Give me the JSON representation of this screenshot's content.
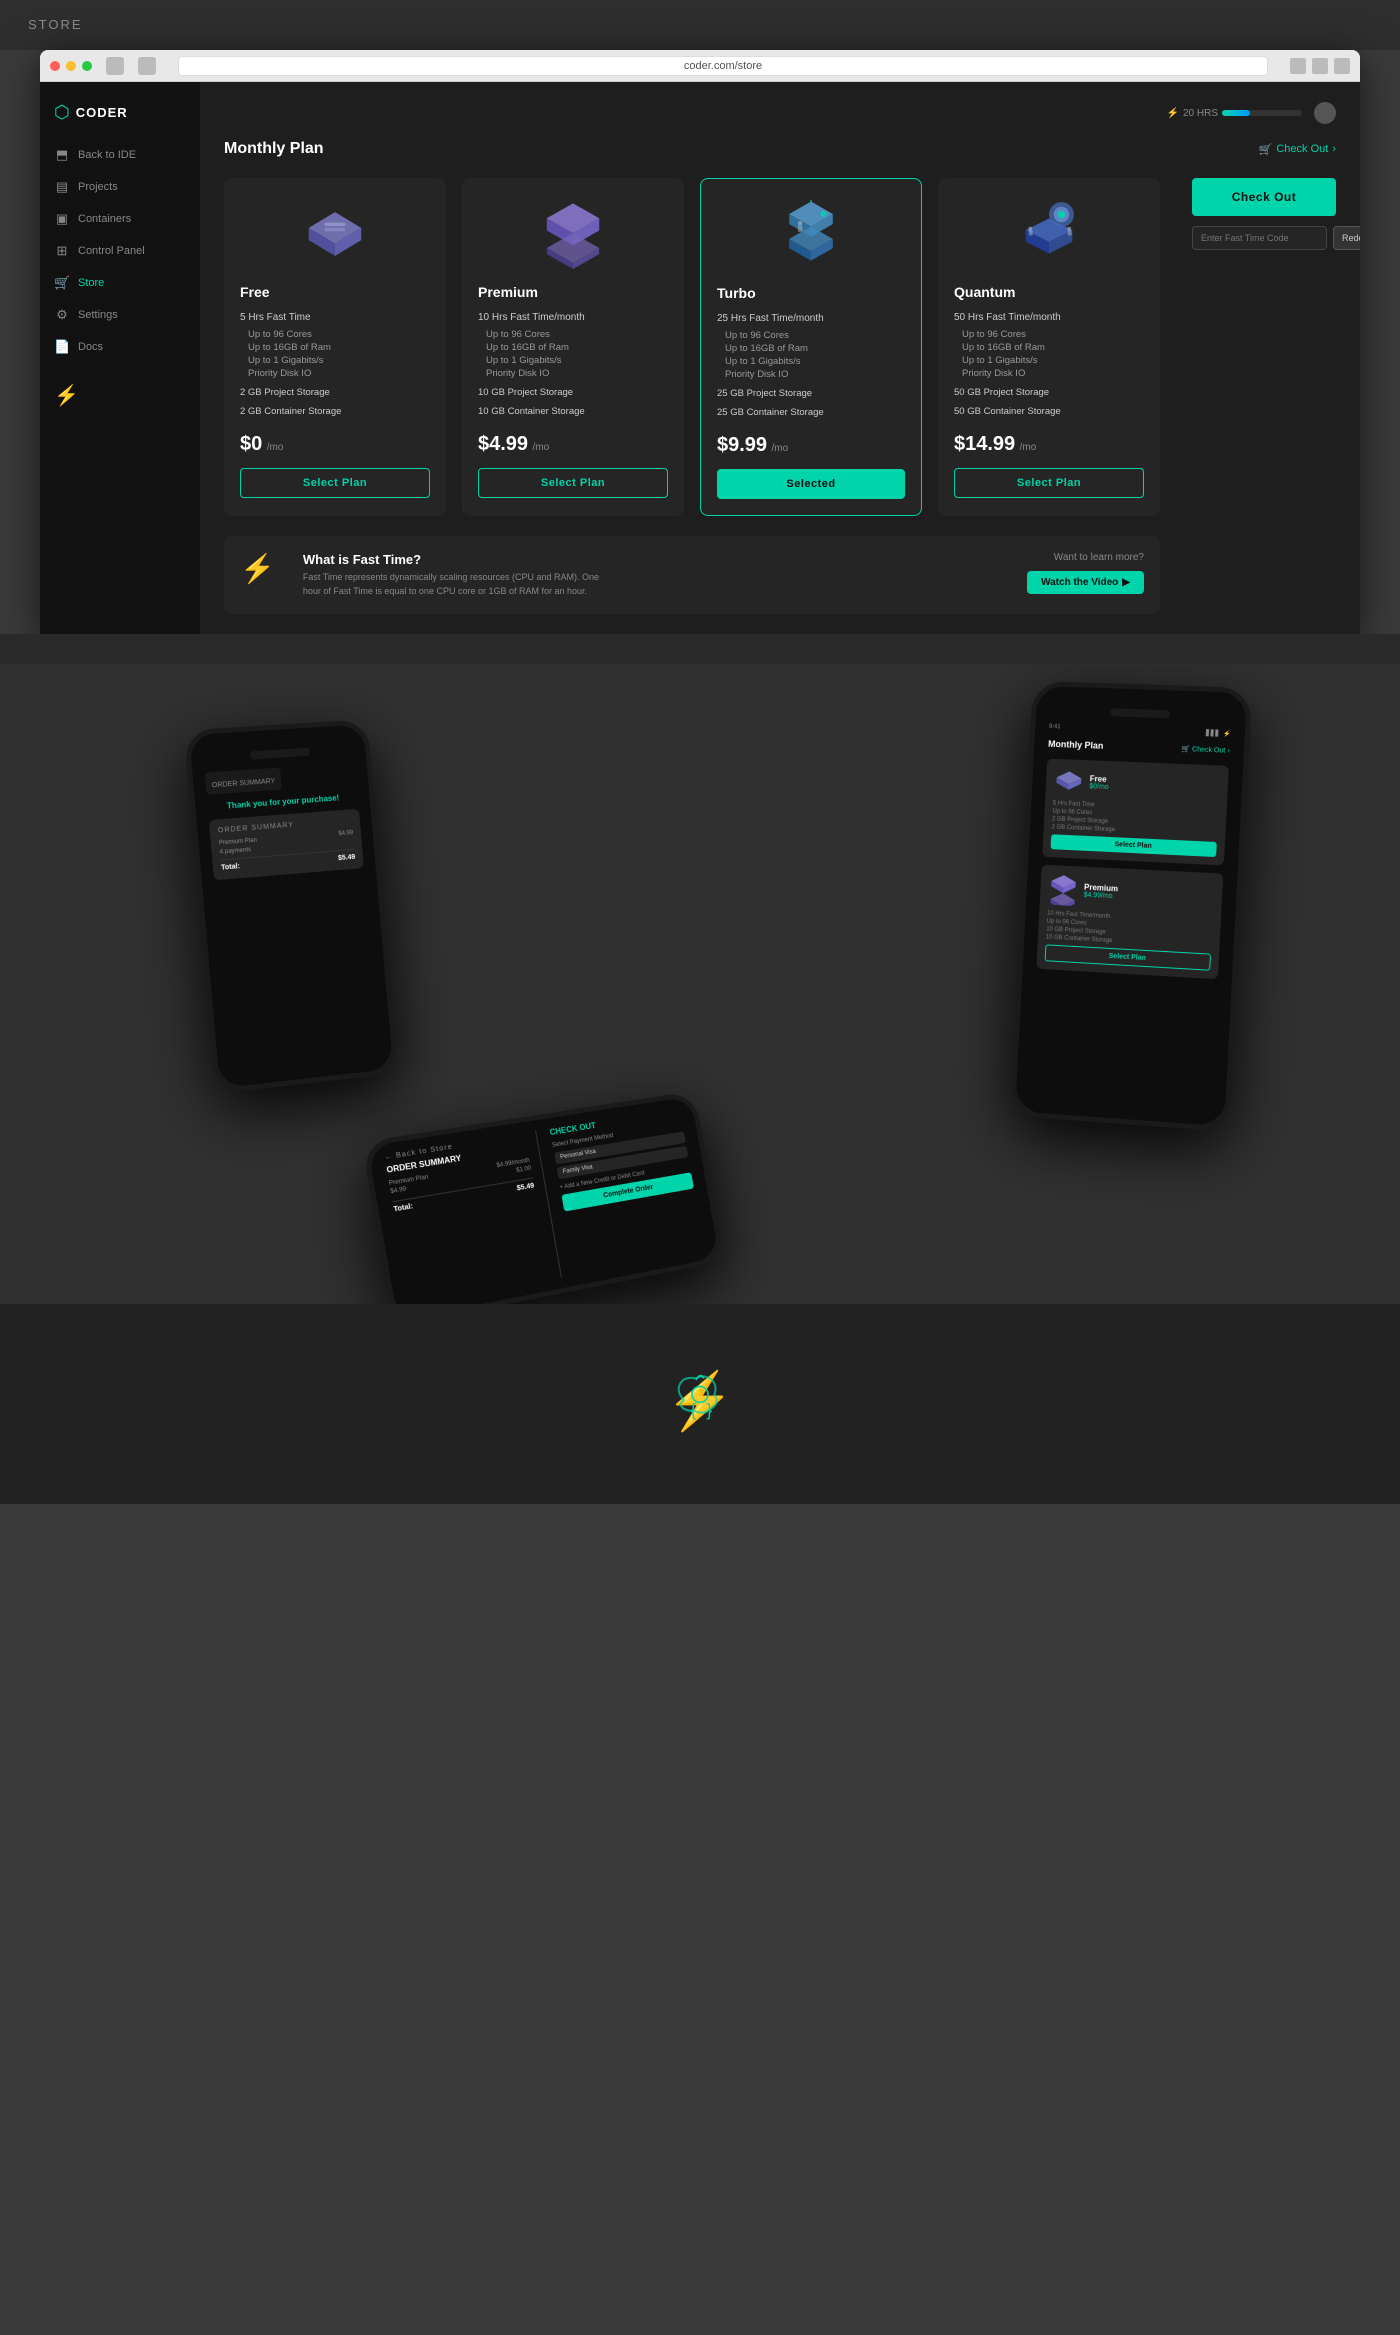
{
  "store_label": "STORE",
  "browser": {
    "url": "coder.com/store"
  },
  "sidebar": {
    "logo_text": "CODER",
    "items": [
      {
        "id": "back-to-ide",
        "label": "Back to IDE",
        "icon": "←"
      },
      {
        "id": "projects",
        "label": "Projects",
        "icon": "▤"
      },
      {
        "id": "containers",
        "label": "Containers",
        "icon": "▣"
      },
      {
        "id": "control-panel",
        "label": "Control Panel",
        "icon": "⊞"
      },
      {
        "id": "store",
        "label": "Store",
        "icon": "🛒",
        "active": true
      },
      {
        "id": "settings",
        "label": "Settings",
        "icon": "⚙"
      },
      {
        "id": "docs",
        "label": "Docs",
        "icon": "📄"
      }
    ]
  },
  "topbar": {
    "fast_time_label": "20 HRS",
    "checkout_link": "Check Out"
  },
  "page": {
    "title": "Monthly Plan"
  },
  "plans": [
    {
      "id": "free",
      "name": "Free",
      "fast_time": "5 Hrs Fast Time",
      "features": [
        "Up to 96 Cores",
        "Up to 16GB of Ram",
        "Up to 1 Gigabits/s",
        "Priority Disk IO"
      ],
      "project_storage": "2 GB Project Storage",
      "container_storage": "2 GB Container Storage",
      "price": "$0",
      "price_suffix": "/mo",
      "btn_label": "Select Plan",
      "selected": false,
      "color": "#7777bb"
    },
    {
      "id": "premium",
      "name": "Premium",
      "fast_time": "10 Hrs Fast Time/month",
      "features": [
        "Up to 96 Cores",
        "Up to 16GB of Ram",
        "Up to 1 Gigabits/s",
        "Priority Disk IO"
      ],
      "project_storage": "10 GB Project Storage",
      "container_storage": "10 GB Container Storage",
      "price": "$4.99",
      "price_suffix": "/mo",
      "btn_label": "Select Plan",
      "selected": false,
      "color": "#8877cc"
    },
    {
      "id": "turbo",
      "name": "Turbo",
      "fast_time": "25 Hrs Fast Time/month",
      "features": [
        "Up to 96 Cores",
        "Up to 16GB of Ram",
        "Up to 1 Gigabits/s",
        "Priority Disk IO"
      ],
      "project_storage": "25 GB Project Storage",
      "container_storage": "25 GB Container Storage",
      "price": "$9.99",
      "price_suffix": "/mo",
      "btn_label": "Selected",
      "selected": true,
      "color": "#5599bb"
    },
    {
      "id": "quantum",
      "name": "Quantum",
      "fast_time": "50 Hrs Fast Time/month",
      "features": [
        "Up to 96 Cores",
        "Up to 16GB of Ram",
        "Up to 1 Gigabits/s",
        "Priority Disk IO"
      ],
      "project_storage": "50 GB Project Storage",
      "container_storage": "50 GB Container Storage",
      "price": "$14.99",
      "price_suffix": "/mo",
      "btn_label": "Select Plan",
      "selected": false,
      "color": "#6688aa"
    }
  ],
  "fast_time_section": {
    "title": "What is Fast Time?",
    "description": "Fast Time represents dynamically scaling resources (CPU and RAM). One hour of Fast Time is equal to one CPU core or 1GB of RAM for an hour.",
    "learn_more": "Want to learn more?",
    "watch_video_btn": "Watch the Video"
  },
  "checkout_panel": {
    "checkout_btn": "Check Out",
    "redeem_placeholder": "Enter Fast Time Code",
    "redeem_btn": "Redeem"
  },
  "phone_screens": {
    "screen1": {
      "title": "Thank you for your purchase!",
      "order_summary": "ORDER SUMMARY",
      "plan": "Premium Plan",
      "payments": "4 payments",
      "amount": "$4.99",
      "total_label": "Total:",
      "total": "$5.49"
    },
    "screen2": {
      "title": "Monthly Plan",
      "back": "← Back to Store",
      "free_name": "Free",
      "free_price": "$0/mo",
      "premium_name": "Premium",
      "premium_price": "$4.99/mo",
      "select_label": "Select Plan"
    },
    "screen3": {
      "order_summary": "ORDER SUMMARY",
      "plan": "Premium Plan",
      "amount": "$4.99/month",
      "total": "$5.49",
      "check_out_title": "CHECK OUT",
      "payment_label": "Select Payment Method",
      "visa": "Personal Visa",
      "family_visa": "Family Visa",
      "complete_btn": "Complete Order"
    }
  },
  "bottom_logo": {
    "alt": "Coder logo"
  }
}
